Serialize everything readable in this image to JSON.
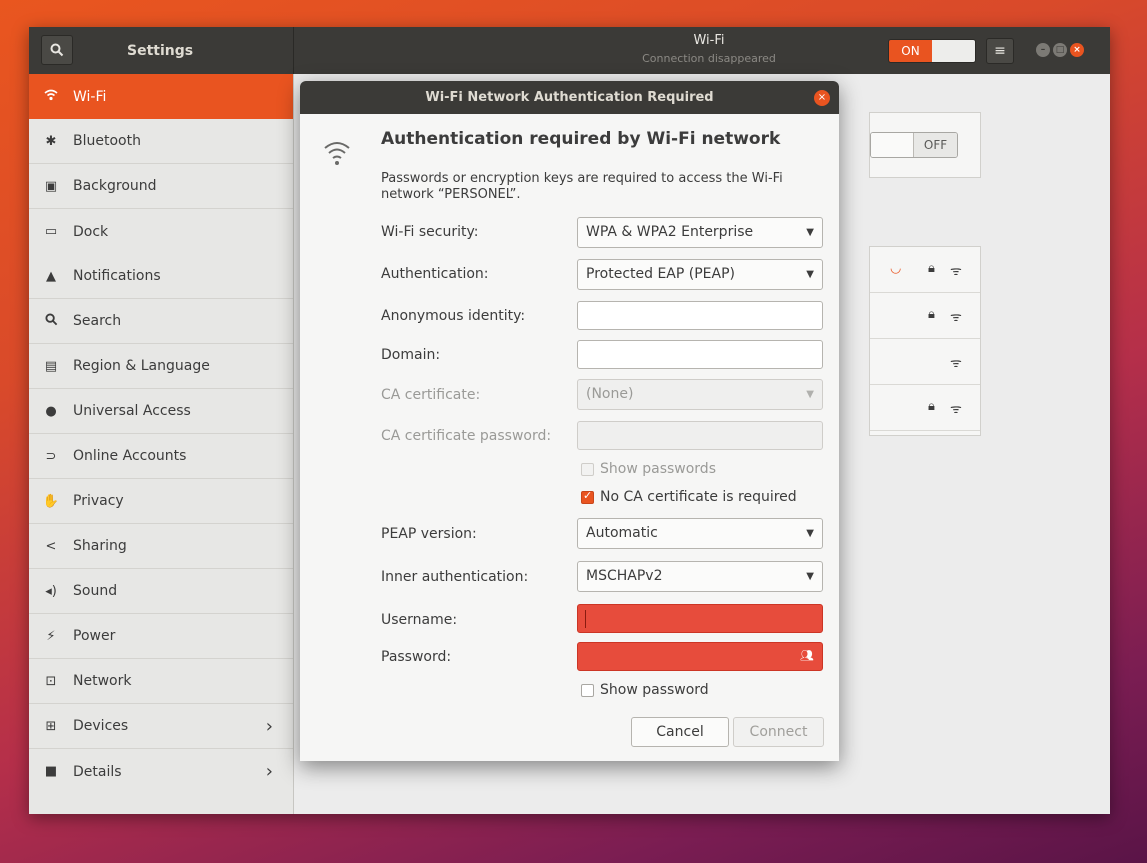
{
  "header": {
    "app_title": "Settings",
    "page_title": "Wi-Fi",
    "page_subtitle": "Connection disappeared",
    "wifi_toggle": "ON",
    "menu_icon": "hamburger-icon",
    "colors": {
      "accent": "#e95420",
      "titlebar": "#3b3a37",
      "sidebar": "#e7e7e5"
    }
  },
  "sidebar": {
    "items": [
      {
        "label": "Wi-Fi",
        "icon": "wifi-icon",
        "active": true
      },
      {
        "label": "Bluetooth",
        "icon": "bluetooth-icon"
      },
      {
        "label": "Background",
        "icon": "background-icon"
      },
      {
        "label": "Dock",
        "icon": "dock-icon"
      },
      {
        "label": "Notifications",
        "icon": "bell-icon"
      },
      {
        "label": "Search",
        "icon": "search-icon"
      },
      {
        "label": "Region & Language",
        "icon": "region-icon"
      },
      {
        "label": "Universal Access",
        "icon": "accessibility-icon"
      },
      {
        "label": "Online Accounts",
        "icon": "online-accounts-icon"
      },
      {
        "label": "Privacy",
        "icon": "hand-icon"
      },
      {
        "label": "Sharing",
        "icon": "share-icon"
      },
      {
        "label": "Sound",
        "icon": "speaker-icon"
      },
      {
        "label": "Power",
        "icon": "power-icon"
      },
      {
        "label": "Network",
        "icon": "network-icon"
      },
      {
        "label": "Devices",
        "icon": "devices-icon",
        "chevron": true
      },
      {
        "label": "Details",
        "icon": "info-icon",
        "chevron": true
      }
    ]
  },
  "airplane": {
    "toggle": "OFF"
  },
  "dialog": {
    "title": "Wi-Fi Network Authentication Required",
    "heading": "Authentication required by Wi-Fi network",
    "description": "Passwords or encryption keys are required to access the Wi-Fi network “PERSONEL”.",
    "fields": {
      "wifi_security": {
        "label": "Wi-Fi security:",
        "value": "WPA & WPA2 Enterprise"
      },
      "authentication": {
        "label": "Authentication:",
        "value": "Protected EAP (PEAP)"
      },
      "anonymous_identity": {
        "label": "Anonymous identity:",
        "value": ""
      },
      "domain": {
        "label": "Domain:",
        "value": ""
      },
      "ca_certificate": {
        "label": "CA certificate:",
        "value": "(None)"
      },
      "ca_certificate_password": {
        "label": "CA certificate password:",
        "value": ""
      },
      "show_passwords": {
        "label": "Show passwords",
        "checked": false
      },
      "no_ca_required": {
        "label": "No CA certificate is required",
        "checked": true
      },
      "peap_version": {
        "label": "PEAP version:",
        "value": "Automatic"
      },
      "inner_authentication": {
        "label": "Inner authentication:",
        "value": "MSCHAPv2"
      },
      "username": {
        "label": "Username:",
        "value": ""
      },
      "password": {
        "label": "Password:",
        "value": ""
      },
      "show_password": {
        "label": "Show password",
        "checked": false
      }
    },
    "buttons": {
      "cancel": "Cancel",
      "connect": "Connect"
    }
  }
}
